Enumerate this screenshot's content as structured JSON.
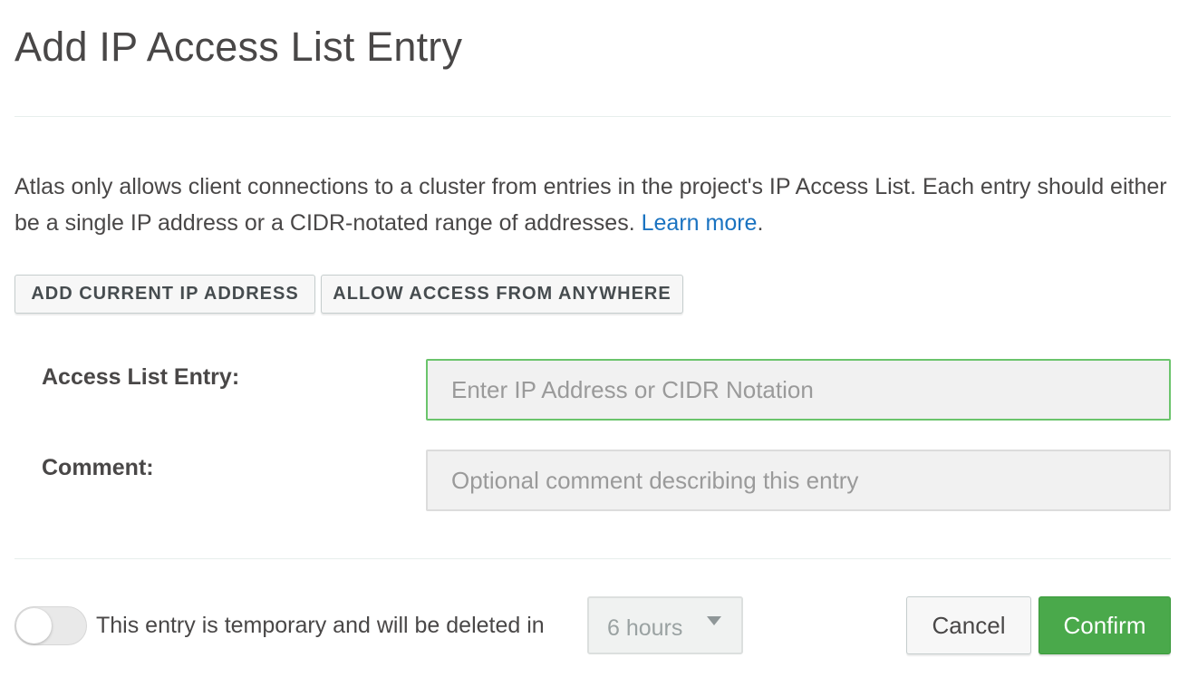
{
  "modal": {
    "title": "Add IP Access List Entry",
    "description": "Atlas only allows client connections to a cluster from entries in the project's IP Access List. Each entry should either be a single IP address or a CIDR-notated range of addresses. ",
    "learn_more_label": "Learn more",
    "learn_more_suffix": "."
  },
  "actions": {
    "add_current_ip_label": "ADD CURRENT IP ADDRESS",
    "allow_anywhere_label": "ALLOW ACCESS FROM ANYWHERE"
  },
  "form": {
    "entry_label": "Access List Entry:",
    "entry_value": "",
    "entry_placeholder": "Enter IP Address or CIDR Notation",
    "comment_label": "Comment:",
    "comment_value": "",
    "comment_placeholder": "Optional comment describing this entry"
  },
  "footer": {
    "temporary_toggle_on": false,
    "temporary_text": "This entry is temporary and will be deleted in",
    "duration_value": "6 hours",
    "cancel_label": "Cancel",
    "confirm_label": "Confirm"
  },
  "colors": {
    "confirm_green": "#4aa94b",
    "link_blue": "#1a73c1",
    "focus_border": "#6bc46c"
  }
}
